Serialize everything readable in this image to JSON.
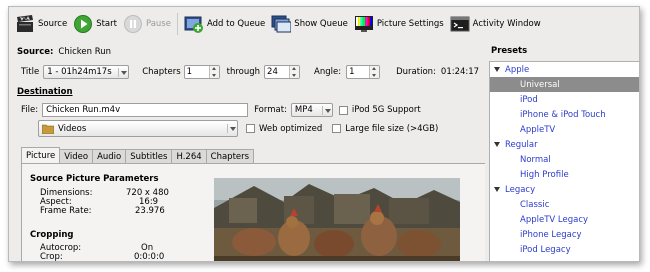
{
  "toolbar": {
    "source": "Source",
    "start": "Start",
    "pause": "Pause",
    "add_to_queue": "Add to Queue",
    "show_queue": "Show Queue",
    "picture_settings": "Picture Settings",
    "activity_window": "Activity Window"
  },
  "source": {
    "label": "Source:",
    "name": "Chicken Run",
    "title_label": "Title",
    "title_value": "1 - 01h24m17s",
    "chapters_label": "Chapters",
    "chapter_from": "1",
    "through_label": "through",
    "chapter_to": "24",
    "angle_label": "Angle:",
    "angle_value": "1",
    "duration_label": "Duration:",
    "duration_value": "01:24:17"
  },
  "destination": {
    "label": "Destination",
    "file_label": "File:",
    "file_value": "Chicken Run.m4v",
    "folder_value": "Videos",
    "format_label": "Format:",
    "format_value": "MP4",
    "ipod_label": "iPod 5G Support",
    "web_label": "Web optimized",
    "large_label": "Large file size (>4GB)"
  },
  "tabs": [
    "Picture",
    "Video",
    "Audio",
    "Subtitles",
    "H.264",
    "Chapters"
  ],
  "picture": {
    "params_title": "Source Picture Parameters",
    "dimensions_label": "Dimensions:",
    "dimensions_value": "720 x 480",
    "aspect_label": "Aspect:",
    "aspect_value": "16:9",
    "framerate_label": "Frame Rate:",
    "framerate_value": "23.976",
    "cropping_title": "Cropping",
    "autocrop_label": "Autocrop:",
    "autocrop_value": "On",
    "crop_label": "Crop:",
    "crop_value": "0:0:0:0"
  },
  "presets": {
    "title": "Presets",
    "items": [
      {
        "label": "Apple",
        "group": true
      },
      {
        "label": "Universal",
        "selected": true
      },
      {
        "label": "iPod"
      },
      {
        "label": "iPhone & iPod Touch"
      },
      {
        "label": "AppleTV"
      },
      {
        "label": "Regular",
        "group": true
      },
      {
        "label": "Normal"
      },
      {
        "label": "High Profile"
      },
      {
        "label": "Legacy",
        "group": true
      },
      {
        "label": "Classic"
      },
      {
        "label": "AppleTV Legacy"
      },
      {
        "label": "iPhone Legacy"
      },
      {
        "label": "iPod Legacy"
      }
    ]
  },
  "colors": {
    "link": "#2a3ccc",
    "selection": "#8c8c8c",
    "window": "#edeceb"
  }
}
